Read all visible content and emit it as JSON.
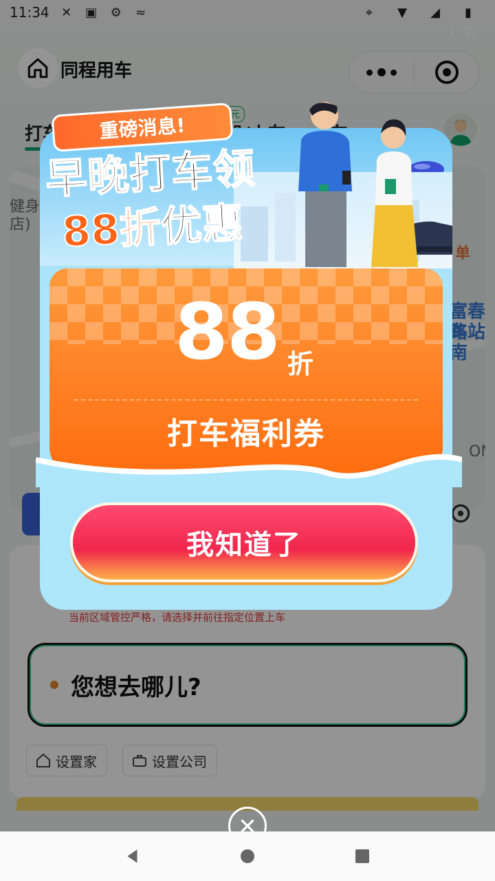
{
  "status_bar": {
    "time": "11:34"
  },
  "header": {
    "app_title": "同程用车",
    "ad_label": "广告"
  },
  "tabs": {
    "items": [
      {
        "label": "打车"
      },
      {
        "label": "机/火车"
      },
      {
        "label": "车"
      }
    ],
    "badge": "减3元"
  },
  "map": {
    "labels": [
      "健身",
      "店)",
      "富春路",
      "车站南",
      "ON"
    ],
    "badge_text": "单"
  },
  "panel": {
    "warning": "当前区域管控严格，请选择并前往指定位置上车",
    "destination_placeholder": "您想去哪儿?",
    "quick_home": "设置家",
    "quick_company": "设置公司"
  },
  "popup": {
    "ribbon": "重磅消息!",
    "headline_line1": "早晚打车领",
    "headline_number": "88折",
    "headline_rest": "优惠",
    "coupon_value": "88",
    "coupon_unit": "折",
    "coupon_name": "打车福利券",
    "confirm_button": "我知道了"
  },
  "colors": {
    "brand_green": "#12a36b",
    "coupon_orange": "#ff6d10",
    "button_red": "#f0264d"
  }
}
